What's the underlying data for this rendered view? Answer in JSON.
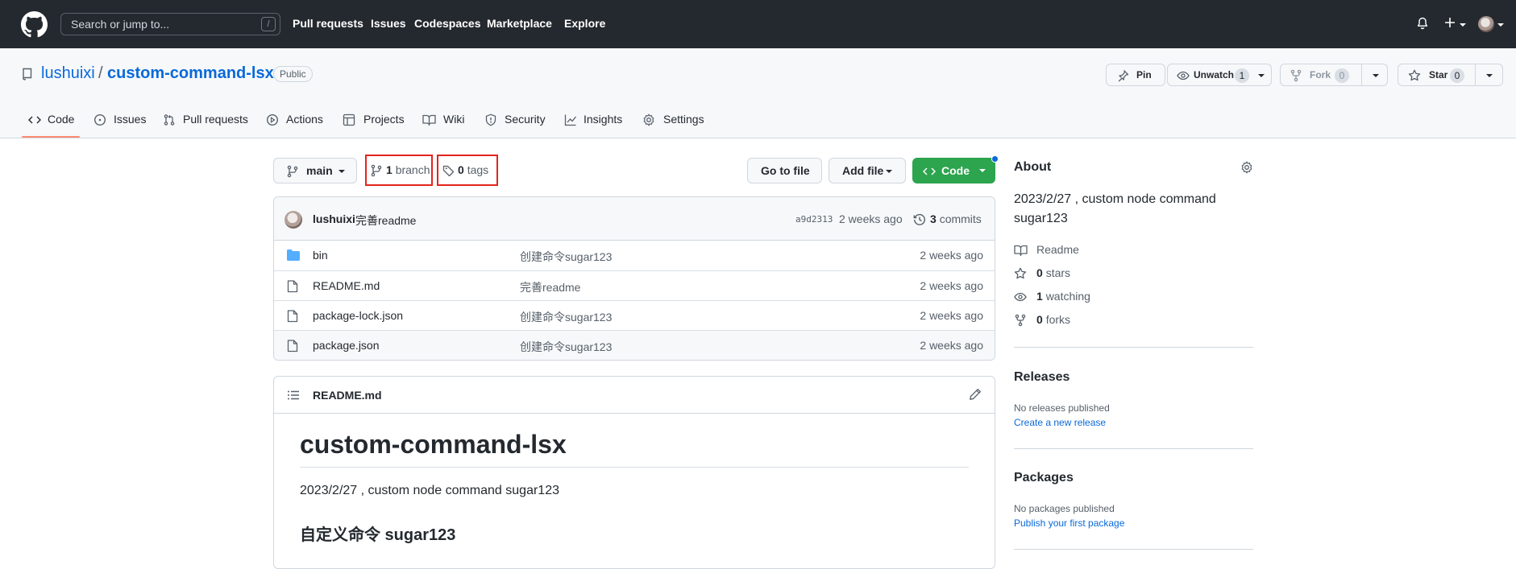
{
  "header": {
    "search_placeholder": "Search or jump to...",
    "search_shortcut": "/",
    "nav": [
      "Pull requests",
      "Issues",
      "Codespaces",
      "Marketplace",
      "Explore"
    ]
  },
  "repo": {
    "owner": "lushuixi",
    "separator": "/",
    "name": "custom-command-lsx",
    "visibility": "Public",
    "pin_label": "Pin",
    "unwatch_label": "Unwatch",
    "watch_count": "1",
    "fork_label": "Fork",
    "fork_count": "0",
    "star_label": "Star",
    "star_count": "0"
  },
  "tabs": [
    "Code",
    "Issues",
    "Pull requests",
    "Actions",
    "Projects",
    "Wiki",
    "Security",
    "Insights",
    "Settings"
  ],
  "branch_bar": {
    "branch_name": "main",
    "branch_count": "1",
    "branch_word": "branch",
    "tag_count": "0",
    "tag_word": "tags",
    "goto_file": "Go to file",
    "add_file": "Add file",
    "code": "Code"
  },
  "latest_commit": {
    "author": "lushuixi",
    "message": "完善readme",
    "sha": "a9d2313",
    "time": "2 weeks ago",
    "commit_count": "3",
    "commit_word": "commits"
  },
  "files": [
    {
      "name": "bin",
      "type": "dir",
      "message": "创建命令sugar123",
      "time": "2 weeks ago"
    },
    {
      "name": "README.md",
      "type": "file",
      "message": "完善readme",
      "time": "2 weeks ago"
    },
    {
      "name": "package-lock.json",
      "type": "file",
      "message": "创建命令sugar123",
      "time": "2 weeks ago"
    },
    {
      "name": "package.json",
      "type": "file",
      "message": "创建命令sugar123",
      "time": "2 weeks ago"
    }
  ],
  "readme": {
    "filename": "README.md",
    "h1": "custom-command-lsx",
    "paragraph": "2023/2/27 , custom node command sugar123",
    "h3": "自定义命令 sugar123"
  },
  "about": {
    "title": "About",
    "description": "2023/2/27 , custom node command sugar123",
    "readme": "Readme",
    "stars_count": "0",
    "stars_word": "stars",
    "watching_count": "1",
    "watching_word": "watching",
    "forks_count": "0",
    "forks_word": "forks"
  },
  "releases": {
    "title": "Releases",
    "empty": "No releases published",
    "link": "Create a new release"
  },
  "packages": {
    "title": "Packages",
    "empty": "No packages published",
    "link": "Publish your first package"
  },
  "colors": {
    "header_bg": "#24292f",
    "link": "#0969da",
    "code_button": "#2da44e",
    "highlight_box": "#e5231e",
    "tab_underline": "#fd8c73"
  }
}
